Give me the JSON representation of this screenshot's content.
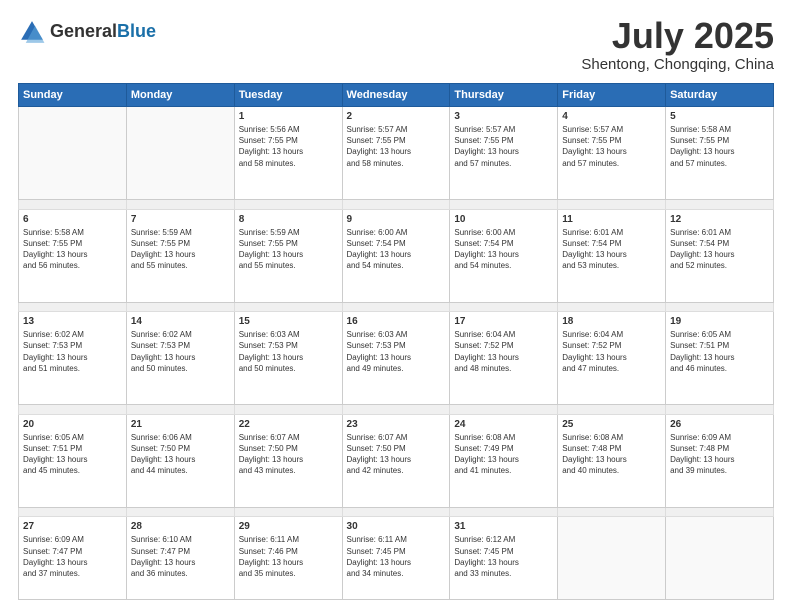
{
  "header": {
    "logo_general": "General",
    "logo_blue": "Blue",
    "month": "July 2025",
    "location": "Shentong, Chongqing, China"
  },
  "weekdays": [
    "Sunday",
    "Monday",
    "Tuesday",
    "Wednesday",
    "Thursday",
    "Friday",
    "Saturday"
  ],
  "weeks": [
    {
      "days": [
        {
          "num": "",
          "info": ""
        },
        {
          "num": "",
          "info": ""
        },
        {
          "num": "1",
          "info": "Sunrise: 5:56 AM\nSunset: 7:55 PM\nDaylight: 13 hours\nand 58 minutes."
        },
        {
          "num": "2",
          "info": "Sunrise: 5:57 AM\nSunset: 7:55 PM\nDaylight: 13 hours\nand 58 minutes."
        },
        {
          "num": "3",
          "info": "Sunrise: 5:57 AM\nSunset: 7:55 PM\nDaylight: 13 hours\nand 57 minutes."
        },
        {
          "num": "4",
          "info": "Sunrise: 5:57 AM\nSunset: 7:55 PM\nDaylight: 13 hours\nand 57 minutes."
        },
        {
          "num": "5",
          "info": "Sunrise: 5:58 AM\nSunset: 7:55 PM\nDaylight: 13 hours\nand 57 minutes."
        }
      ]
    },
    {
      "days": [
        {
          "num": "6",
          "info": "Sunrise: 5:58 AM\nSunset: 7:55 PM\nDaylight: 13 hours\nand 56 minutes."
        },
        {
          "num": "7",
          "info": "Sunrise: 5:59 AM\nSunset: 7:55 PM\nDaylight: 13 hours\nand 55 minutes."
        },
        {
          "num": "8",
          "info": "Sunrise: 5:59 AM\nSunset: 7:55 PM\nDaylight: 13 hours\nand 55 minutes."
        },
        {
          "num": "9",
          "info": "Sunrise: 6:00 AM\nSunset: 7:54 PM\nDaylight: 13 hours\nand 54 minutes."
        },
        {
          "num": "10",
          "info": "Sunrise: 6:00 AM\nSunset: 7:54 PM\nDaylight: 13 hours\nand 54 minutes."
        },
        {
          "num": "11",
          "info": "Sunrise: 6:01 AM\nSunset: 7:54 PM\nDaylight: 13 hours\nand 53 minutes."
        },
        {
          "num": "12",
          "info": "Sunrise: 6:01 AM\nSunset: 7:54 PM\nDaylight: 13 hours\nand 52 minutes."
        }
      ]
    },
    {
      "days": [
        {
          "num": "13",
          "info": "Sunrise: 6:02 AM\nSunset: 7:53 PM\nDaylight: 13 hours\nand 51 minutes."
        },
        {
          "num": "14",
          "info": "Sunrise: 6:02 AM\nSunset: 7:53 PM\nDaylight: 13 hours\nand 50 minutes."
        },
        {
          "num": "15",
          "info": "Sunrise: 6:03 AM\nSunset: 7:53 PM\nDaylight: 13 hours\nand 50 minutes."
        },
        {
          "num": "16",
          "info": "Sunrise: 6:03 AM\nSunset: 7:53 PM\nDaylight: 13 hours\nand 49 minutes."
        },
        {
          "num": "17",
          "info": "Sunrise: 6:04 AM\nSunset: 7:52 PM\nDaylight: 13 hours\nand 48 minutes."
        },
        {
          "num": "18",
          "info": "Sunrise: 6:04 AM\nSunset: 7:52 PM\nDaylight: 13 hours\nand 47 minutes."
        },
        {
          "num": "19",
          "info": "Sunrise: 6:05 AM\nSunset: 7:51 PM\nDaylight: 13 hours\nand 46 minutes."
        }
      ]
    },
    {
      "days": [
        {
          "num": "20",
          "info": "Sunrise: 6:05 AM\nSunset: 7:51 PM\nDaylight: 13 hours\nand 45 minutes."
        },
        {
          "num": "21",
          "info": "Sunrise: 6:06 AM\nSunset: 7:50 PM\nDaylight: 13 hours\nand 44 minutes."
        },
        {
          "num": "22",
          "info": "Sunrise: 6:07 AM\nSunset: 7:50 PM\nDaylight: 13 hours\nand 43 minutes."
        },
        {
          "num": "23",
          "info": "Sunrise: 6:07 AM\nSunset: 7:50 PM\nDaylight: 13 hours\nand 42 minutes."
        },
        {
          "num": "24",
          "info": "Sunrise: 6:08 AM\nSunset: 7:49 PM\nDaylight: 13 hours\nand 41 minutes."
        },
        {
          "num": "25",
          "info": "Sunrise: 6:08 AM\nSunset: 7:48 PM\nDaylight: 13 hours\nand 40 minutes."
        },
        {
          "num": "26",
          "info": "Sunrise: 6:09 AM\nSunset: 7:48 PM\nDaylight: 13 hours\nand 39 minutes."
        }
      ]
    },
    {
      "days": [
        {
          "num": "27",
          "info": "Sunrise: 6:09 AM\nSunset: 7:47 PM\nDaylight: 13 hours\nand 37 minutes."
        },
        {
          "num": "28",
          "info": "Sunrise: 6:10 AM\nSunset: 7:47 PM\nDaylight: 13 hours\nand 36 minutes."
        },
        {
          "num": "29",
          "info": "Sunrise: 6:11 AM\nSunset: 7:46 PM\nDaylight: 13 hours\nand 35 minutes."
        },
        {
          "num": "30",
          "info": "Sunrise: 6:11 AM\nSunset: 7:45 PM\nDaylight: 13 hours\nand 34 minutes."
        },
        {
          "num": "31",
          "info": "Sunrise: 6:12 AM\nSunset: 7:45 PM\nDaylight: 13 hours\nand 33 minutes."
        },
        {
          "num": "",
          "info": ""
        },
        {
          "num": "",
          "info": ""
        }
      ]
    }
  ]
}
